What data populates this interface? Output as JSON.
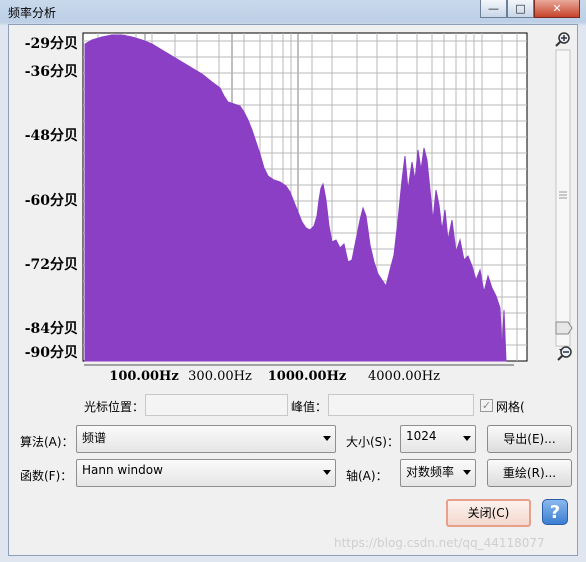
{
  "window": {
    "title": "频率分析",
    "min_glyph": "—",
    "max_glyph": "□",
    "close_glyph": "✕"
  },
  "plot": {
    "y_ticks": [
      "-29分贝",
      "-36分贝",
      "-48分贝",
      "-60分贝",
      "-72分贝",
      "-84分贝",
      "-90分贝"
    ],
    "x_ticks": [
      "100.00Hz",
      "300.00Hz",
      "1000.00Hz",
      "4000.00Hz"
    ],
    "fill_color": "#8a3fc4",
    "grid": true
  },
  "cursor": {
    "label": "光标位置：",
    "value": "",
    "peak_label": "峰值：",
    "peak_value": "",
    "grid_label": "网格(",
    "grid_checked": true
  },
  "controls": {
    "algorithm_label": "算法(A)：",
    "algorithm_value": "频谱",
    "size_label": "大小(S)：",
    "size_value": "1024",
    "export_label": "导出(E)...",
    "function_label": "函数(F)：",
    "function_value": "Hann window",
    "axis_label": "轴(A)：",
    "axis_value": "对数频率",
    "replot_label": "重绘(R)...",
    "close_label": "关闭(C)",
    "help_glyph": "?"
  },
  "watermark": "https://blog.csdn.net/qq_44118077"
}
